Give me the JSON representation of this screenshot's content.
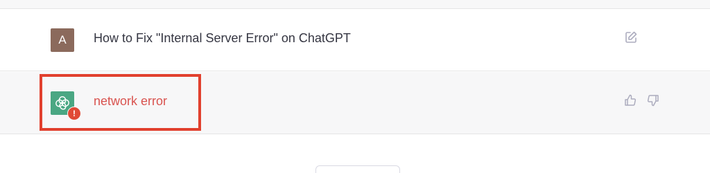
{
  "conversation": {
    "user_message": {
      "avatar_letter": "A",
      "avatar_color": "#8b6a5c",
      "text": "How to Fix \"Internal Server Error\" on ChatGPT",
      "action_icon": "edit-icon"
    },
    "assistant_message": {
      "avatar_icon": "openai-logo-icon",
      "avatar_color": "#4aa783",
      "error_badge_icon": "exclamation-icon",
      "error_badge_symbol": "!",
      "text": "network error",
      "text_color": "#d9534f",
      "actions": [
        "thumbs-up-icon",
        "thumbs-down-icon"
      ]
    }
  },
  "annotation": {
    "highlight_color": "#e1402e"
  }
}
